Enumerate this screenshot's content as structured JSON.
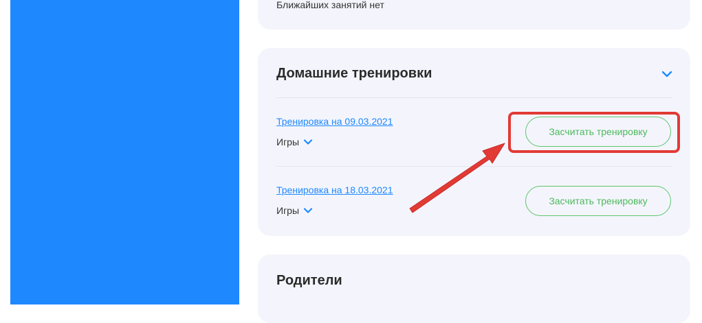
{
  "upcoming": {
    "empty_text": "Ближайших занятий нет"
  },
  "home_workouts": {
    "title": "Домашние тренировки",
    "items": [
      {
        "link": "Тренировка на 09.03.2021",
        "category": "Игры",
        "button": "Засчитать тренировку"
      },
      {
        "link": "Тренировка на 18.03.2021",
        "category": "Игры",
        "button": "Засчитать тренировку"
      }
    ]
  },
  "parents": {
    "title": "Родители"
  },
  "colors": {
    "accent_blue": "#1e88ff",
    "button_green": "#4db85c",
    "annotation_red": "#e23a35",
    "card_bg": "#f4f5fc"
  },
  "icons": {
    "collapse": "chevron-down-icon"
  }
}
